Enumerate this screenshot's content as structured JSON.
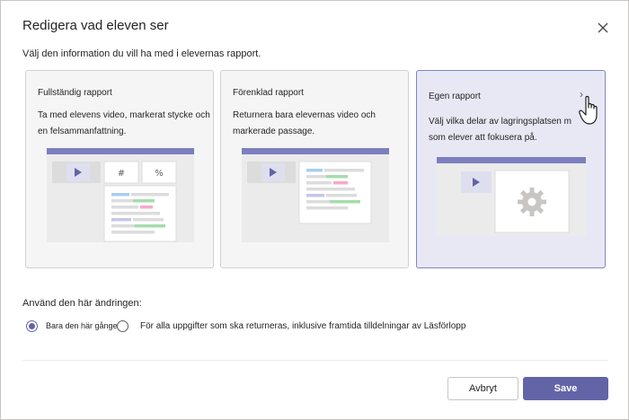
{
  "dialog": {
    "title": "Redigera vad eleven ser",
    "subtitle": "Välj den information du vill ha med i elevernas rapport."
  },
  "cards": [
    {
      "title": "Fullständig rapport",
      "description": "Ta med elevens video, markerat stycke och en felsammanfattning.",
      "tiles": [
        "#",
        "%"
      ],
      "selected": false
    },
    {
      "title": "Förenklad rapport",
      "description": "Returnera bara elevernas video och markerade passage.",
      "selected": false
    },
    {
      "title": "Egen rapport",
      "description": "Välj vilka delar av lagringsplatsen m som elever att fokusera på.",
      "selected": true,
      "chevron": "›"
    }
  ],
  "apply": {
    "label": "Använd den här ändringen:",
    "options": [
      {
        "label": "Bara den här gången",
        "checked": true
      },
      {
        "label": "För alla uppgifter som ska returneras, inklusive framtida tilldelningar av Läsförlopp",
        "checked": false
      }
    ]
  },
  "buttons": {
    "cancel": "Avbryt",
    "save": "Save"
  },
  "colors": {
    "accent": "#6264a7",
    "card_bg": "#f5f5f5",
    "card_selected_bg": "#e8e8f5",
    "highlight_blue": "#a9cdf0",
    "highlight_green": "#a6dcad",
    "highlight_pink": "#f7a8c8",
    "highlight_purple": "#c5c7e8"
  },
  "icons": [
    "close-icon",
    "play-icon",
    "settings-gear-icon",
    "chevron-right-icon",
    "hand-pointer-icon"
  ]
}
